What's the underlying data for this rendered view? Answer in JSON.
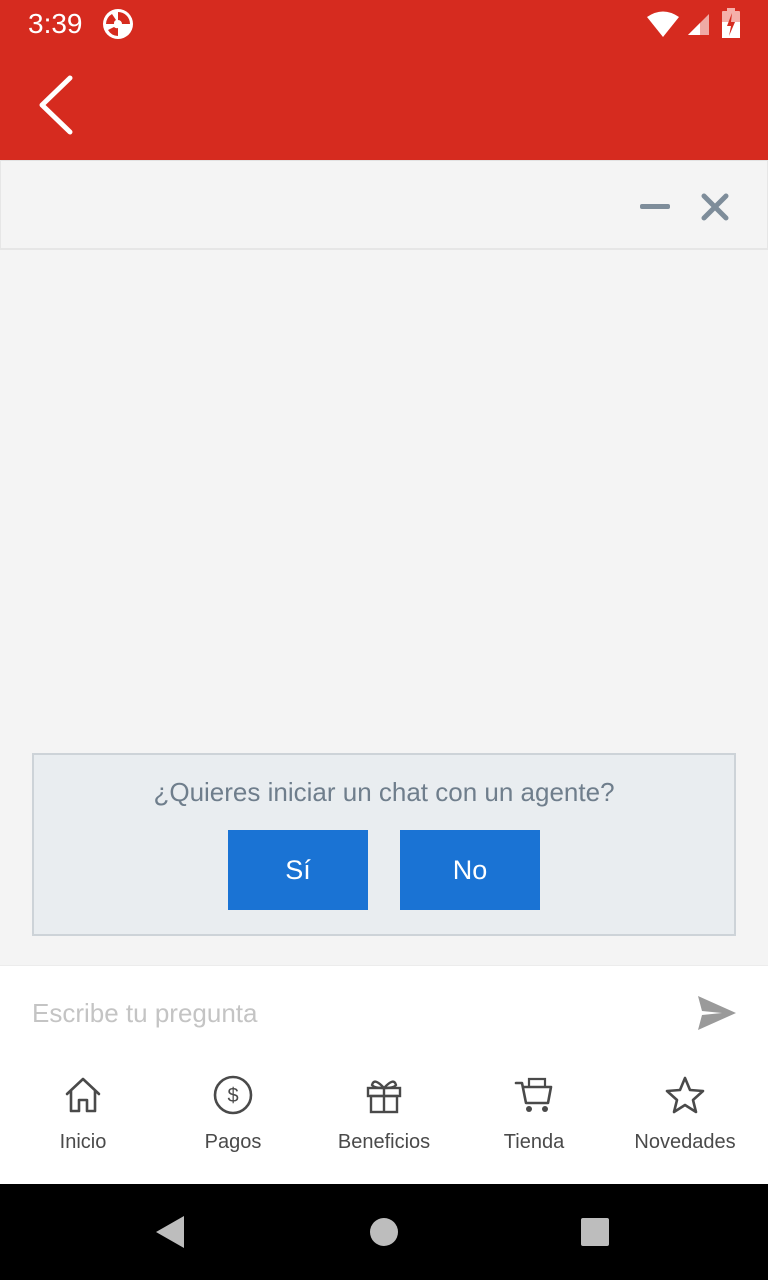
{
  "status_bar": {
    "time": "3:39"
  },
  "colors": {
    "brand_red": "#d62b1f",
    "button_blue": "#1a73d4",
    "prompt_text": "#6f7e8c"
  },
  "chat_header": {
    "minimize_icon": "minimize-icon",
    "close_icon": "close-icon"
  },
  "prompt": {
    "question": "¿Quieres iniciar un chat con un agente?",
    "yes_label": "Sí",
    "no_label": "No"
  },
  "input": {
    "placeholder": "Escribe tu pregunta",
    "value": ""
  },
  "bottom_nav": {
    "items": [
      {
        "label": "Inicio",
        "icon": "home-icon"
      },
      {
        "label": "Pagos",
        "icon": "dollar-circle-icon"
      },
      {
        "label": "Beneficios",
        "icon": "gift-icon"
      },
      {
        "label": "Tienda",
        "icon": "cart-icon"
      },
      {
        "label": "Novedades",
        "icon": "star-icon"
      }
    ]
  }
}
